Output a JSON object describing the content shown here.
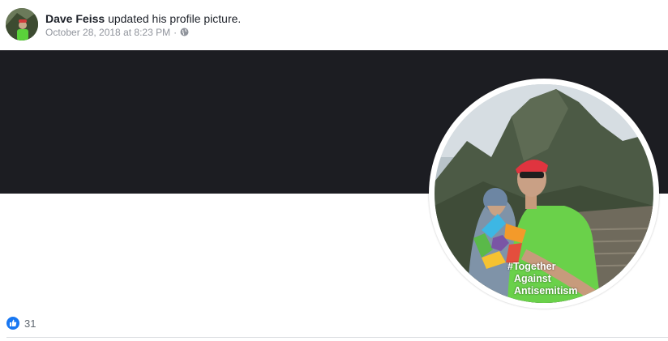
{
  "post": {
    "author": "Dave Feiss",
    "action": "updated his profile picture.",
    "timestamp": "October 28, 2018 at 8:23 PM",
    "separator": "·",
    "privacy_icon": "globe-icon"
  },
  "profile_frame": {
    "line1": "#Together",
    "line2": "Against",
    "line3": "Antisemitism"
  },
  "reactions": {
    "icon": "like-icon",
    "count": "31"
  },
  "colors": {
    "cover": "#1c1d22",
    "like_blue": "#1877f2",
    "shirt_green": "#6ad14a"
  }
}
